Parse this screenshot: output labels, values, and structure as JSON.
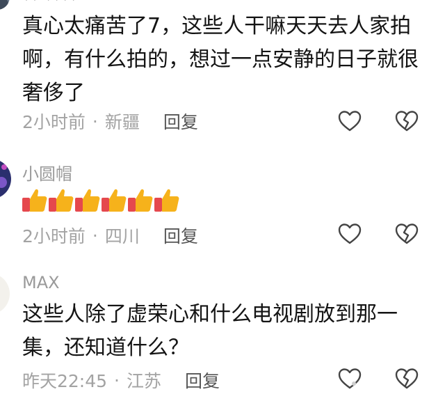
{
  "comments": [
    {
      "username": "** ****",
      "content": "真心太痛苦了7，这些人干嘛天天去人家拍啊，有什么拍的，想过一点安静的日子就很奢侈了",
      "time": "2小时前",
      "separator": "·",
      "location": "新疆",
      "reply_label": "回复",
      "like_icon": "heart-outline-icon",
      "dislike_icon": "broken-heart-icon"
    },
    {
      "username": "小圆帽",
      "content_emojis": [
        "👍",
        "👍",
        "👍",
        "👍",
        "👍",
        "👍"
      ],
      "time": "2小时前",
      "separator": "·",
      "location": "四川",
      "reply_label": "回复",
      "like_icon": "heart-outline-icon",
      "dislike_icon": "broken-heart-icon"
    },
    {
      "username": "MAX",
      "content": "这些人除了虚荣心和什么电视剧放到那一集，还知道什么？",
      "time": "昨天22:45",
      "separator": "·",
      "location": "江苏",
      "reply_label": "回复",
      "like_icon": "heart-outline-icon",
      "dislike_icon": "broken-heart-icon"
    }
  ],
  "colors": {
    "text": "#141414",
    "meta": "#a3a3a3",
    "username": "#9a9a9a",
    "icon": "#444444",
    "thumb_yellow": "#f6b21b",
    "thumb_red": "#e5484d"
  }
}
